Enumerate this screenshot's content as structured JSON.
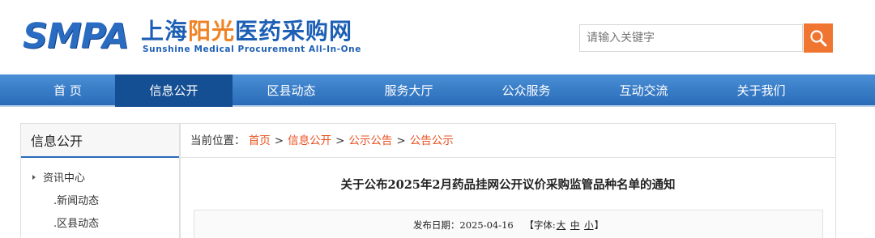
{
  "header": {
    "logo_abbr": "SMPA",
    "logo_cn_part1": "上海",
    "logo_cn_part2": "阳光",
    "logo_cn_part3": "医药采购网",
    "logo_en": "Sunshine Medical Procurement All-In-One",
    "search_placeholder": "请输入关键字"
  },
  "nav": {
    "items": [
      "首 页",
      "信息公开",
      "区县动态",
      "服务大厅",
      "公众服务",
      "互动交流",
      "关于我们"
    ],
    "active_index": 1
  },
  "sidebar": {
    "title": "信息公开",
    "parent": "资讯中心",
    "children": [
      ".新闻动态",
      ".区县动态"
    ]
  },
  "breadcrumb": {
    "prefix": "当前位置：",
    "items": [
      "首页",
      "信息公开",
      "公示公告",
      "公告公示"
    ],
    "separator": ">"
  },
  "article": {
    "title": "关于公布2025年2月药品挂网公开议价采购监管品种名单的通知",
    "date_label": "发布日期：",
    "date": "2025-04-16",
    "font_label": "【字体:",
    "font_sizes": [
      "大",
      "中",
      "小"
    ],
    "font_close": "】"
  },
  "colors": {
    "brand_blue": "#2a6cc2",
    "nav_active": "#154f93",
    "link_orange": "#e8501f",
    "search_button": "#f07530"
  }
}
